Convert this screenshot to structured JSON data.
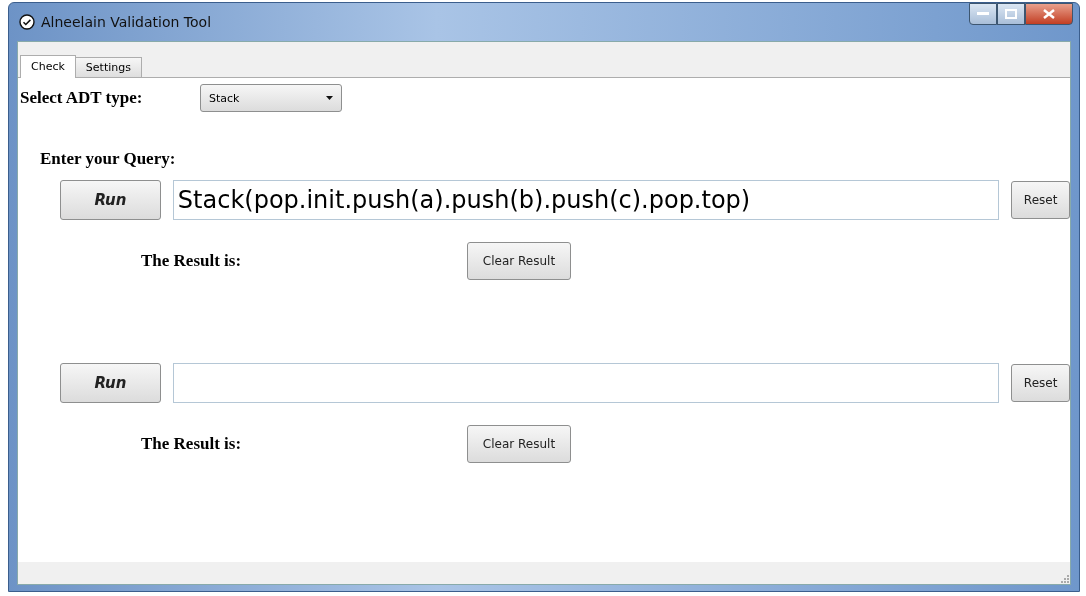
{
  "window": {
    "title": "Alneelain Validation Tool"
  },
  "tabs": [
    {
      "label": "Check",
      "selected": true
    },
    {
      "label": "Settings",
      "selected": false
    }
  ],
  "adt_type": {
    "label": "Select ADT type:",
    "value": "Stack"
  },
  "query_heading": "Enter your Query:",
  "queries": [
    {
      "run": "Run",
      "value": "Stack(pop.init.push(a).push(b).push(c).pop.top)",
      "reset": "Reset",
      "result_label": "The Result is:",
      "clear": "Clear Result"
    },
    {
      "run": "Run",
      "reset": "Reset",
      "result_label": "The Result is:",
      "clear": "Clear Result"
    }
  ]
}
